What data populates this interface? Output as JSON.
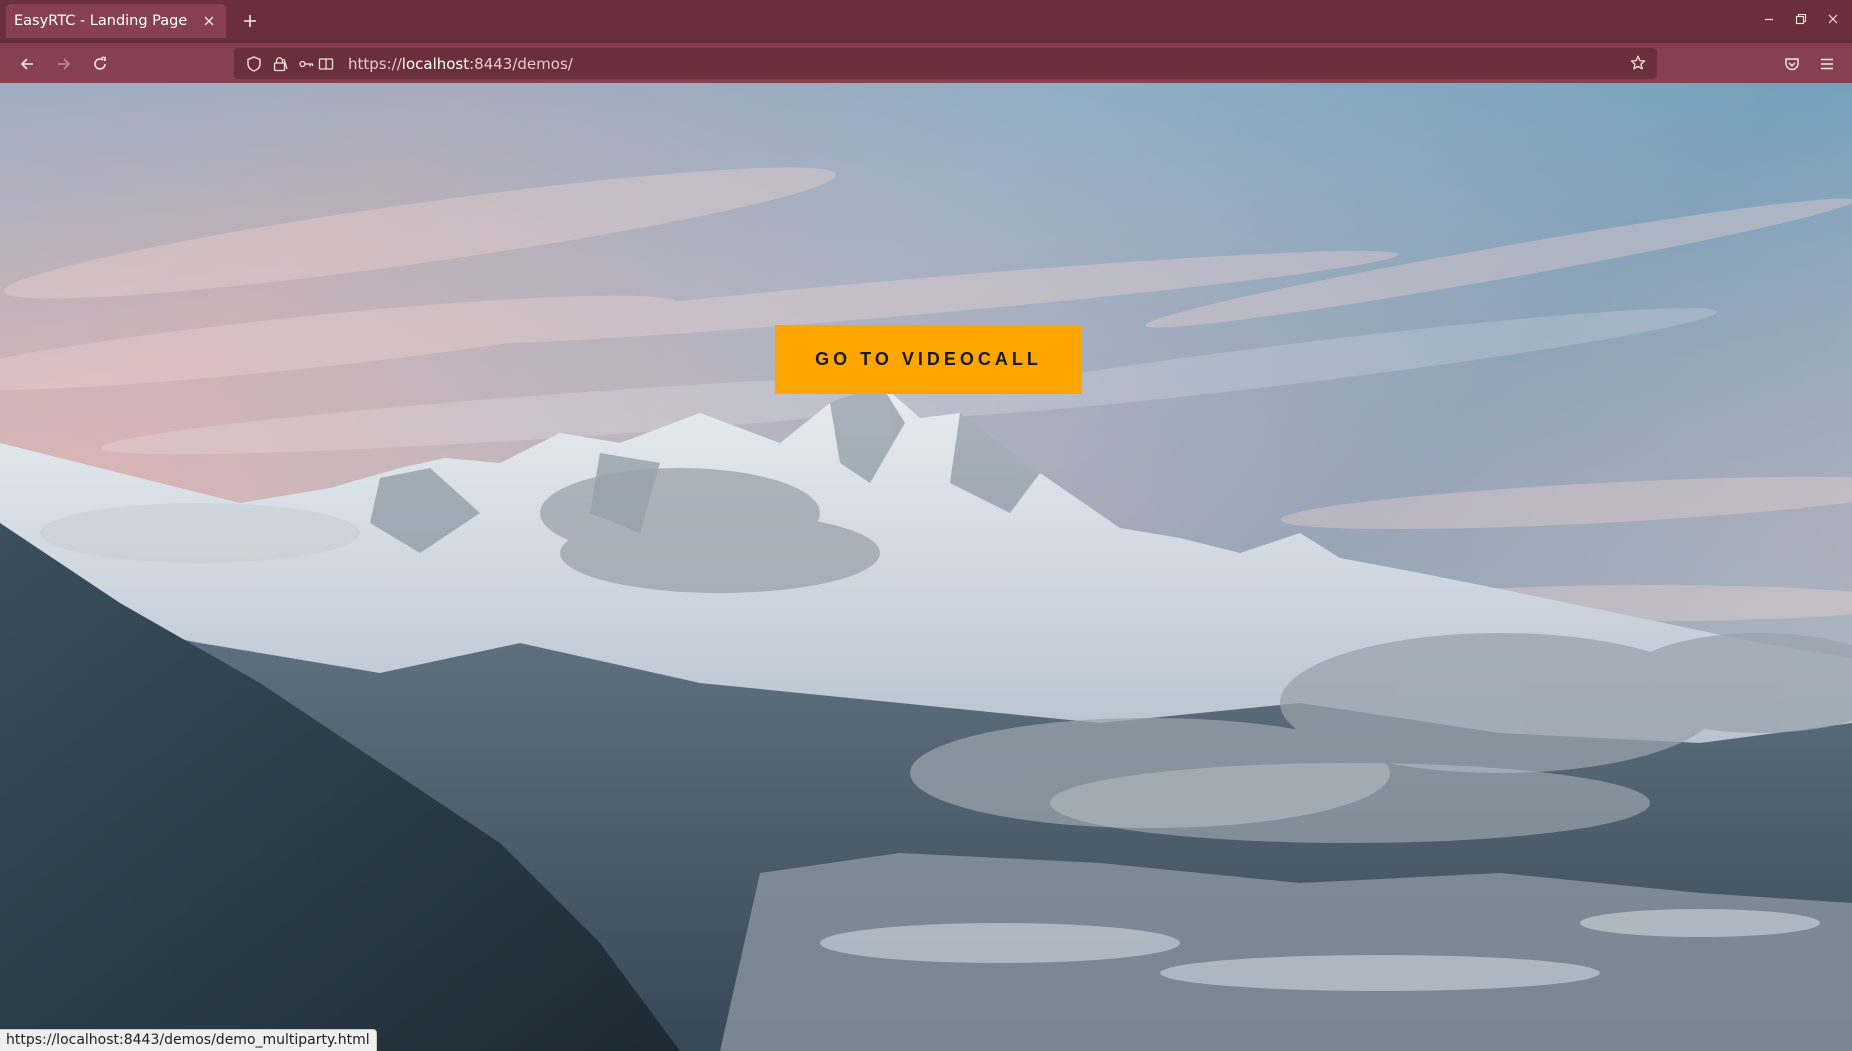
{
  "browser": {
    "tab": {
      "title": "EasyRTC - Landing Page",
      "close_icon": "close-icon"
    },
    "new_tab_icon": "plus-icon",
    "window_controls": [
      "minimize-icon",
      "restore-icon",
      "close-icon"
    ],
    "nav": {
      "back_icon": "arrow-left-icon",
      "forward_icon": "arrow-right-icon",
      "reload_icon": "reload-icon"
    },
    "url": {
      "scheme": "https://",
      "host": "localhost",
      "rest": ":8443/demos/",
      "icons": [
        "shield-icon",
        "lock-icon",
        "permissions-icon",
        "reader-icon"
      ],
      "bookmark_icon": "star-icon"
    },
    "toolbar_right": [
      "pocket-icon",
      "hamburger-menu-icon"
    ],
    "status_url": "https://localhost:8443/demos/demo_multiparty.html"
  },
  "page": {
    "cta_label": "GO TO VIDEOCALL"
  },
  "colors": {
    "tab_strip": "#6b2f3c",
    "toolbar": "#86404f",
    "cta": "#ffa500"
  }
}
